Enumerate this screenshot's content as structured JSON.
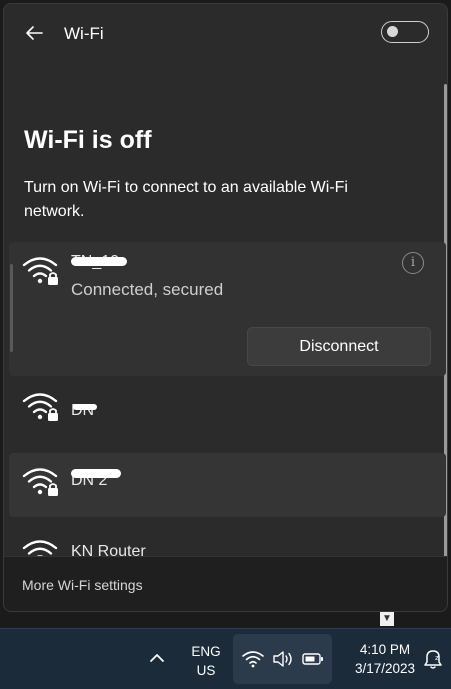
{
  "header": {
    "back_icon": "back-arrow-icon",
    "title": "Wi-Fi",
    "toggle_state": "off"
  },
  "status": {
    "title": "Wi-Fi is off",
    "description": "Turn on Wi-Fi to connect to an available Wi-Fi network."
  },
  "networks": [
    {
      "name": "TN_10",
      "status": "Connected, secured",
      "secured": true,
      "action": "Disconnect",
      "info_glyph": "i"
    },
    {
      "name": "DN",
      "secured": true
    },
    {
      "name": "DN 2",
      "secured": true
    },
    {
      "name": "KN Router",
      "secured": true
    }
  ],
  "footer": {
    "link": "More Wi-Fi settings"
  },
  "taskbar": {
    "lang_line1": "ENG",
    "lang_line2": "US",
    "time": "4:10 PM",
    "date": "3/17/2023",
    "icons": [
      "chevron-up-icon",
      "wifi-icon",
      "volume-icon",
      "battery-icon",
      "notification-bell-icon"
    ]
  },
  "colors": {
    "panel": "#2b2b2b",
    "taskbar": "#1c2b3a",
    "text": "#ffffff"
  }
}
